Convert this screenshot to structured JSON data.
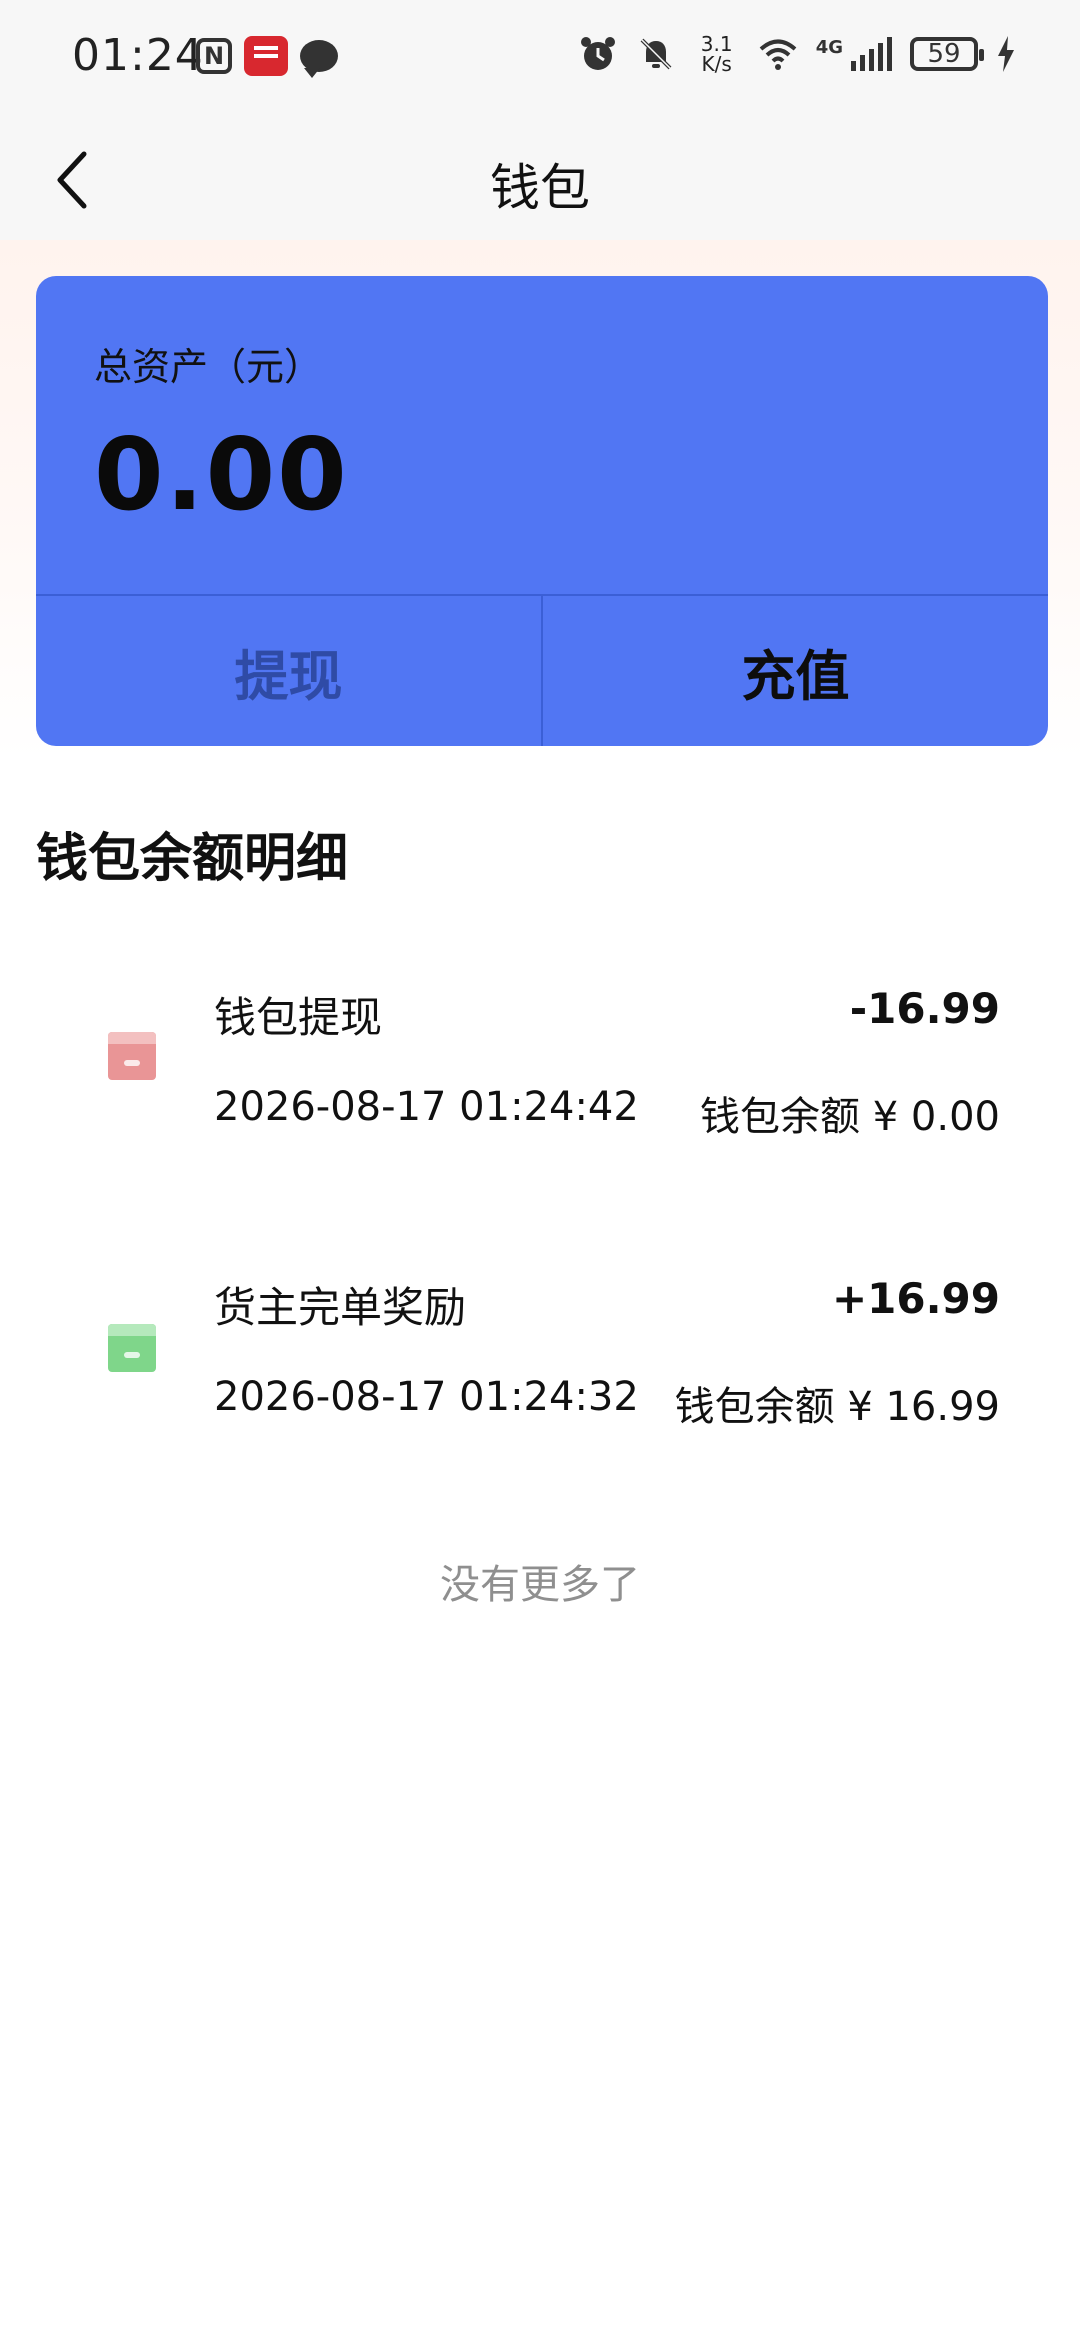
{
  "status_bar": {
    "time": "01:24",
    "net_speed_value": "3.1",
    "net_speed_unit": "K/s",
    "network": "4G",
    "battery": "59",
    "icons": [
      "nfc-icon",
      "pay-icon",
      "chat-icon",
      "alarm-icon",
      "mute-bell-icon",
      "wifi-icon",
      "signal-icon",
      "battery-icon",
      "charging-icon"
    ]
  },
  "header": {
    "title": "钱包"
  },
  "asset_card": {
    "label": "总资产（元）",
    "value": "0.00",
    "withdraw_label": "提现",
    "recharge_label": "充值",
    "card_color": "#5176f3"
  },
  "section": {
    "title": "钱包余额明细"
  },
  "transactions": [
    {
      "title": "钱包提现",
      "amount": "-16.99",
      "date": "2026-08-17 01:24:42",
      "balance": "钱包余额 ¥ 0.00",
      "icon": "withdraw-icon",
      "icon_color": "#e99596"
    },
    {
      "title": "货主完单奖励",
      "amount": "+16.99",
      "date": "2026-08-17 01:24:32",
      "balance": "钱包余额 ¥ 16.99",
      "icon": "reward-icon",
      "icon_color": "#7fd68a"
    }
  ],
  "footer": {
    "no_more": "没有更多了"
  }
}
